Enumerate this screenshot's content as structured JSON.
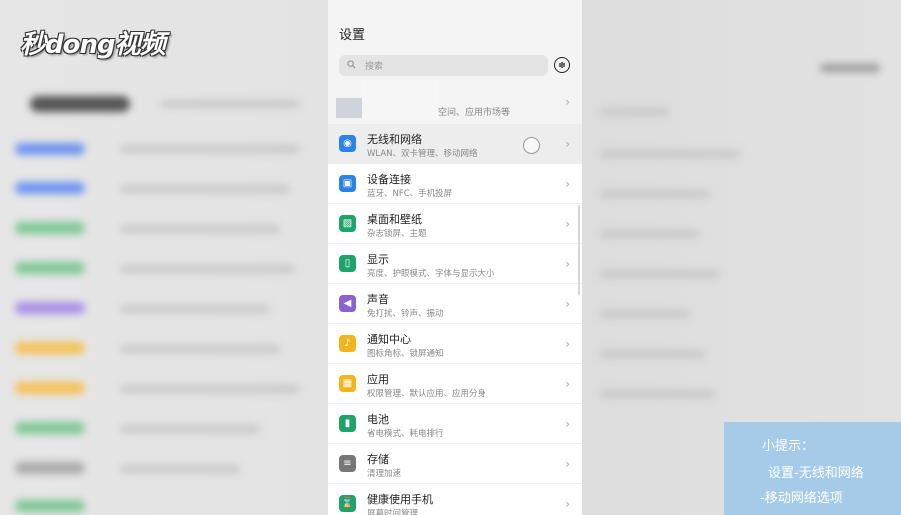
{
  "watermark": "秒dong视频",
  "phone": {
    "title": "设置",
    "search_placeholder": "搜索",
    "account_subtitle": "空间、应用市场等"
  },
  "settings_items": [
    {
      "name": "wlan",
      "title": "无线和网络",
      "subtitle": "WLAN、双卡管理、移动网络",
      "color": "#2b82e8",
      "icon": "wifi-icon",
      "glyph": "◉",
      "selected": true
    },
    {
      "name": "device-connect",
      "title": "设备连接",
      "subtitle": "蓝牙、NFC、手机投屏",
      "color": "#2b82e8",
      "icon": "device-connect-icon",
      "glyph": "▣"
    },
    {
      "name": "desktop",
      "title": "桌面和壁纸",
      "subtitle": "杂志锁屏、主题",
      "color": "#1ea36b",
      "icon": "wallpaper-icon",
      "glyph": "▨"
    },
    {
      "name": "display",
      "title": "显示",
      "subtitle": "亮度、护眼模式、字体与显示大小",
      "color": "#1ea36b",
      "icon": "display-icon",
      "glyph": "▯"
    },
    {
      "name": "sound",
      "title": "声音",
      "subtitle": "免打扰、铃声、振动",
      "color": "#8a63d2",
      "icon": "speaker-icon",
      "glyph": "◀"
    },
    {
      "name": "notification",
      "title": "通知中心",
      "subtitle": "图标角标、锁屏通知",
      "color": "#f2b51e",
      "icon": "bell-icon",
      "glyph": "♪"
    },
    {
      "name": "apps",
      "title": "应用",
      "subtitle": "权限管理、默认应用、应用分身",
      "color": "#f2b51e",
      "icon": "apps-grid-icon",
      "glyph": "▦"
    },
    {
      "name": "battery",
      "title": "电池",
      "subtitle": "省电模式、耗电排行",
      "color": "#1ea36b",
      "icon": "battery-icon",
      "glyph": "▮"
    },
    {
      "name": "storage",
      "title": "存储",
      "subtitle": "清理加速",
      "color": "#777777",
      "icon": "storage-icon",
      "glyph": "≡"
    },
    {
      "name": "digital-balance",
      "title": "健康使用手机",
      "subtitle": "屏幕时间管理",
      "color": "#1ea36b",
      "icon": "hourglass-icon",
      "glyph": "⌛"
    }
  ],
  "tip": {
    "title": "小提示：",
    "line1": "设置-无线和网络",
    "line2": "-移动网络选项"
  }
}
